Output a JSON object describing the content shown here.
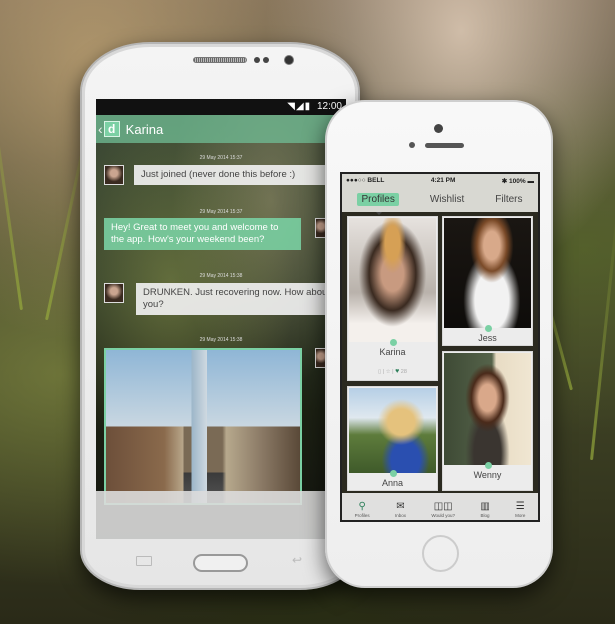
{
  "android": {
    "status_time": "12:00",
    "status_icons": "wifi-signal-battery",
    "header": {
      "back_icon": "chevron-left-icon",
      "logo_letter": "d",
      "contact_name": "Karina"
    },
    "messages": [
      {
        "timestamp": "29 May 2014 15:37",
        "direction": "incoming",
        "text": "Just joined (never done this before :)"
      },
      {
        "timestamp": "29 May 2014 15:37",
        "direction": "outgoing",
        "text": "Hey! Great to meet you and welcome to the app. How's your weekend been?"
      },
      {
        "timestamp": "29 May 2014 15:38",
        "direction": "incoming",
        "text": "DRUNKEN. Just recovering now. How about you?"
      },
      {
        "timestamp": "29 May 2014 15:38",
        "direction": "outgoing",
        "type": "image",
        "image_desc": "city street photo"
      }
    ]
  },
  "iphone": {
    "status": {
      "carrier": "●●●○○ BELL",
      "time": "4:21 PM",
      "battery": "100%"
    },
    "tabs": [
      {
        "label": "Profiles",
        "active": true
      },
      {
        "label": "Wishlist",
        "active": false
      },
      {
        "label": "Filters",
        "active": false
      }
    ],
    "profiles": [
      {
        "name": "Karina",
        "likes": "28"
      },
      {
        "name": "Jess"
      },
      {
        "name": "Anna"
      },
      {
        "name": "Wenny"
      }
    ],
    "tabbar": [
      {
        "label": "Profiles",
        "icon": "map-pin-icon",
        "glyph": "⚲",
        "active": true
      },
      {
        "label": "Inbox",
        "icon": "inbox-icon",
        "glyph": "✉",
        "active": false
      },
      {
        "label": "Would you?",
        "icon": "cards-icon",
        "glyph": "◫◫",
        "active": false
      },
      {
        "label": "Blog",
        "icon": "book-icon",
        "glyph": "▥",
        "active": false
      },
      {
        "label": "More",
        "icon": "menu-icon",
        "glyph": "☰",
        "active": false
      }
    ]
  },
  "colors": {
    "accent": "#7bd0a4",
    "accent_dark": "#2d7f5a"
  }
}
